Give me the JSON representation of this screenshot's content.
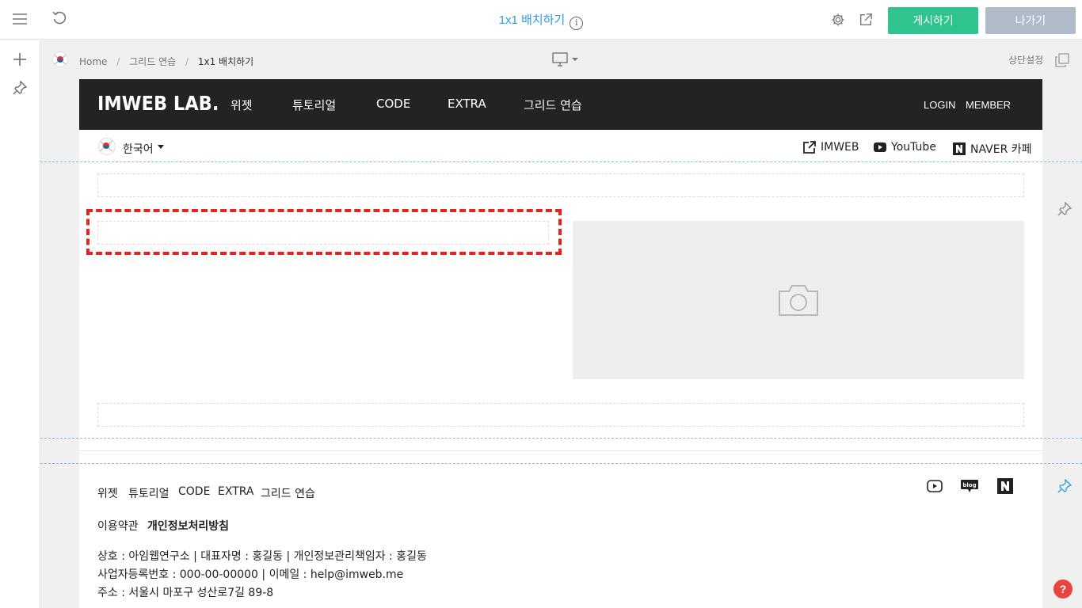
{
  "topbar": {
    "title": "1x1 배치하기",
    "info_icon": "i",
    "publish_label": "게시하기",
    "exit_label": "나가기"
  },
  "breadcrumb": {
    "home": "Home",
    "sep": "/",
    "parent": "그리드 연습",
    "current": "1x1 배치하기"
  },
  "top_setting_label": "상단설정",
  "site": {
    "logo": "IMWEB LAB.",
    "nav": [
      "위젯",
      "튜토리얼",
      "CODE",
      "EXTRA",
      "그리드 연습"
    ],
    "login": "LOGIN",
    "member": "MEMBER",
    "language": "한국어",
    "links": [
      "IMWEB",
      "YouTube",
      "NAVER 카페"
    ]
  },
  "footer": {
    "nav": [
      "위젯",
      "튜토리얼",
      "CODE",
      "EXTRA",
      "그리드 연습"
    ],
    "terms": "이용약관",
    "privacy": "개인정보처리방침",
    "info_line1": "상호 : 아임웹연구소 | 대표자명 : 홍길동 | 개인정보관리책임자 : 홍길동",
    "info_line2": "사업자등록번호 : 000-00-00000 | 이메일 : help@imweb.me",
    "info_line3": "주소 : 서울시 마포구 성산로7길 89-8",
    "blog_label": "blog"
  },
  "help_label": "?",
  "colors": {
    "title_blue": "#2b9de0",
    "publish_green": "#2fc48d",
    "exit_gray": "#b0bac8",
    "header_dark": "#232323",
    "selection_red": "#e8231b",
    "guide_blue": "#7cc0e8"
  }
}
